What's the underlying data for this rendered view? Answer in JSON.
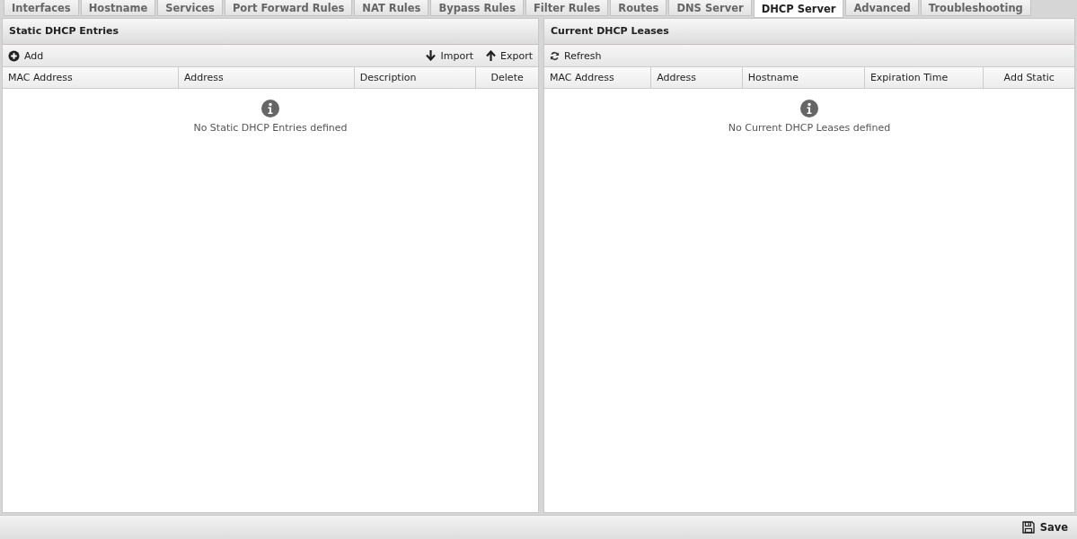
{
  "tabs": [
    {
      "label": "Interfaces",
      "selected": false
    },
    {
      "label": "Hostname",
      "selected": false
    },
    {
      "label": "Services",
      "selected": false
    },
    {
      "label": "Port Forward Rules",
      "selected": false
    },
    {
      "label": "NAT Rules",
      "selected": false
    },
    {
      "label": "Bypass Rules",
      "selected": false
    },
    {
      "label": "Filter Rules",
      "selected": false
    },
    {
      "label": "Routes",
      "selected": false
    },
    {
      "label": "DNS Server",
      "selected": false
    },
    {
      "label": "DHCP Server",
      "selected": true
    },
    {
      "label": "Advanced",
      "selected": false
    },
    {
      "label": "Troubleshooting",
      "selected": false
    }
  ],
  "panels": [
    {
      "title": "Static DHCP Entries",
      "toolbar_left": [
        {
          "kind": "add",
          "label": "Add"
        }
      ],
      "toolbar_right": [
        {
          "kind": "import",
          "label": "Import"
        },
        {
          "kind": "export",
          "label": "Export"
        }
      ],
      "columns": [
        "MAC Address",
        "Address",
        "Description",
        "Delete"
      ],
      "empty_text": "No Static DHCP Entries defined"
    },
    {
      "title": "Current DHCP Leases",
      "toolbar_left": [
        {
          "kind": "refresh",
          "label": "Refresh"
        }
      ],
      "columns": [
        "MAC Address",
        "Address",
        "Hostname",
        "Expiration Time",
        "Add Static"
      ],
      "empty_text": "No Current DHCP Leases defined"
    }
  ],
  "footer": {
    "save_label": "Save"
  }
}
